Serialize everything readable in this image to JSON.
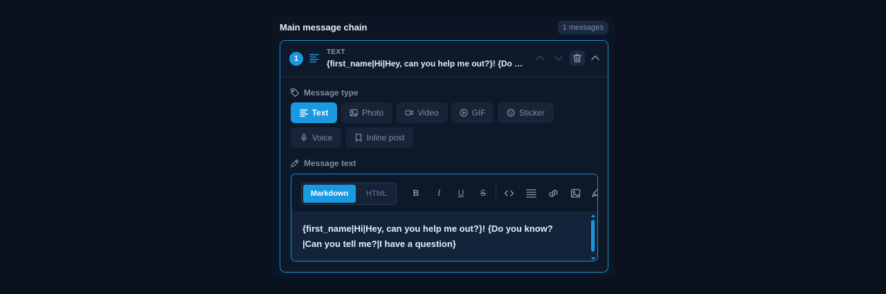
{
  "chain": {
    "title": "Main message chain",
    "count_badge": "1 messages"
  },
  "message": {
    "number": "1",
    "type_label": "TEXT",
    "preview": "{first_name|Hi|Hey, can you help me out?}! {Do y...",
    "head_icon": "text-lines-icon",
    "actions": [
      "move-up-icon",
      "move-down-icon",
      "trash-icon",
      "chevron-up-icon"
    ]
  },
  "message_type": {
    "label": "Message type",
    "options": [
      {
        "label": "Text",
        "icon": "text-lines-icon",
        "active": true
      },
      {
        "label": "Photo",
        "icon": "image-icon",
        "active": false
      },
      {
        "label": "Video",
        "icon": "video-icon",
        "active": false
      },
      {
        "label": "GIF",
        "icon": "play-circle-icon",
        "active": false
      },
      {
        "label": "Sticker",
        "icon": "smile-icon",
        "active": false
      },
      {
        "label": "Voice",
        "icon": "microphone-icon",
        "active": false
      },
      {
        "label": "Inline post",
        "icon": "bookmark-icon",
        "active": false
      }
    ]
  },
  "message_text": {
    "label": "Message text",
    "modes": {
      "markdown": "Markdown",
      "html": "HTML"
    },
    "active_mode": "Markdown",
    "tools": {
      "bold": "B",
      "italic": "I",
      "underline": "U",
      "strike": "S"
    },
    "tool_icons": [
      "code-icon",
      "align-icon",
      "link-icon",
      "image-icon",
      "brush-icon"
    ],
    "line1": "{first_name|Hi|Hey, can you help me out?}! {Do you know?",
    "line2": "|Can you tell me?|I have a question}"
  },
  "colors": {
    "accent": "#1899e0",
    "background": "#0a1220",
    "card": "#0d1828"
  }
}
